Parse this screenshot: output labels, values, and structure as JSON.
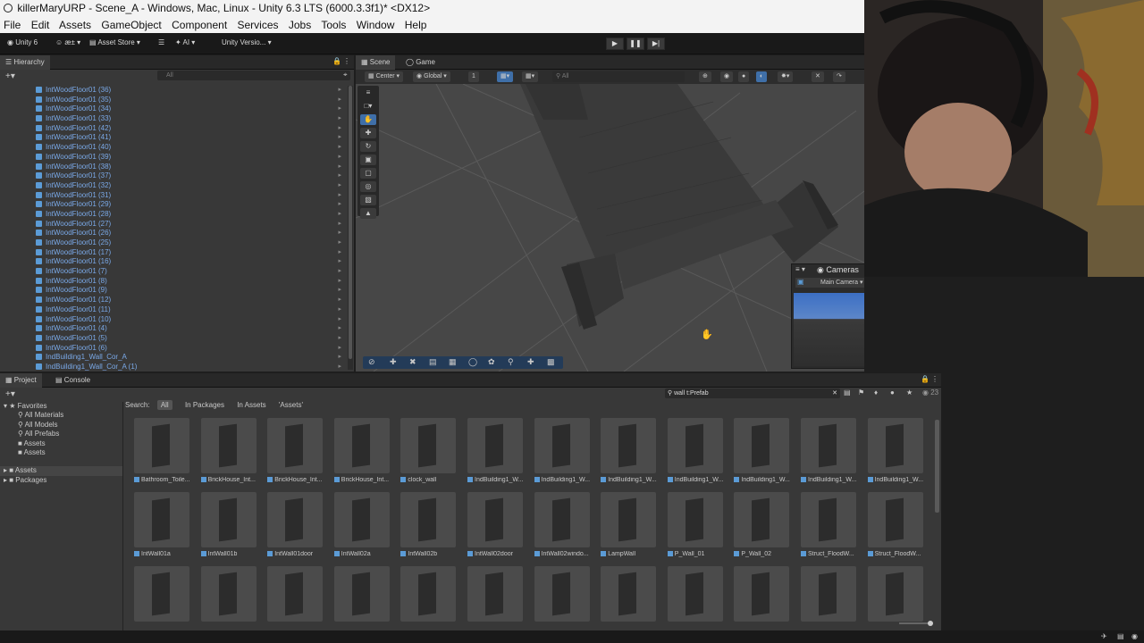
{
  "window": {
    "title": "killerMaryURP - Scene_A - Windows, Mac, Linux - Unity 6.3 LTS (6000.3.3f1)* <DX12>"
  },
  "menu": [
    "File",
    "Edit",
    "Assets",
    "GameObject",
    "Component",
    "Services",
    "Jobs",
    "Tools",
    "Window",
    "Help"
  ],
  "toolbar": {
    "unity_label": "Unity 6",
    "account_label": "æ±",
    "asset_store_label": "Asset Store ▾",
    "ai_label": "AI ▾",
    "version_control_label": "Unity Versio... ▾",
    "play_icon": "play-icon",
    "pause_icon": "pause-icon",
    "step_icon": "step-icon"
  },
  "hierarchy": {
    "tab_label": "Hierarchy",
    "search_placeholder": "All",
    "items": [
      "IntWoodFloor01 (36)",
      "IntWoodFloor01 (35)",
      "IntWoodFloor01 (34)",
      "IntWoodFloor01 (33)",
      "IntWoodFloor01 (42)",
      "IntWoodFloor01 (41)",
      "IntWoodFloor01 (40)",
      "IntWoodFloor01 (39)",
      "IntWoodFloor01 (38)",
      "IntWoodFloor01 (37)",
      "IntWoodFloor01 (32)",
      "IntWoodFloor01 (31)",
      "IntWoodFloor01 (29)",
      "IntWoodFloor01 (28)",
      "IntWoodFloor01 (27)",
      "IntWoodFloor01 (26)",
      "IntWoodFloor01 (25)",
      "IntWoodFloor01 (17)",
      "IntWoodFloor01 (16)",
      "IntWoodFloor01 (7)",
      "IntWoodFloor01 (8)",
      "IntWoodFloor01 (9)",
      "IntWoodFloor01 (12)",
      "IntWoodFloor01 (11)",
      "IntWoodFloor01 (10)",
      "IntWoodFloor01 (4)",
      "IntWoodFloor01 (5)",
      "IntWoodFloor01 (6)",
      "IndBuilding1_Wall_Cor_A",
      "IndBuilding1_Wall_Cor_A (1)"
    ]
  },
  "scene": {
    "tab_scene": "Scene",
    "tab_game": "Game",
    "pivot_label": "Center",
    "space_label": "Global",
    "grid_value": "1",
    "search_placeholder": "All",
    "cameras_title": "Cameras",
    "camera_selected": "Main Camera"
  },
  "project": {
    "tab_project": "Project",
    "tab_console": "Console",
    "search_query": "wall t:Prefab",
    "count": "23",
    "search_label": "Search:",
    "filters": [
      "All",
      "In Packages",
      "In Assets",
      "'Assets'"
    ],
    "favorites_label": "Favorites",
    "favorites": [
      "All Materials",
      "All Models",
      "All Prefabs",
      "Assets",
      "Assets"
    ],
    "roots": [
      "Assets",
      "Packages"
    ],
    "assets": [
      "Bathroom_Toile...",
      "BrickHouse_Int...",
      "BrickHouse_Int...",
      "BrickHouse_Int...",
      "clock_wall",
      "IndBuilding1_W...",
      "IndBuilding1_W...",
      "IndBuilding1_W...",
      "IndBuilding1_W...",
      "IndBuilding1_W...",
      "IndBuilding1_W...",
      "IndBuilding1_W...",
      "IntWall01a",
      "IntWall01b",
      "IntWall01door",
      "IntWall02a",
      "IntWall02b",
      "IntWall02door",
      "IntWall02windo...",
      "LampWall",
      "P_Wall_01",
      "P_Wall_02",
      "Struct_FloodW...",
      "Struct_FloodW...",
      "",
      "",
      "",
      "",
      "",
      "",
      "",
      "",
      "",
      "",
      "",
      ""
    ]
  },
  "colors": {
    "accent_blue": "#3f6fa8",
    "prefab_blue": "#7aa9e8",
    "panel_bg": "#383838"
  }
}
